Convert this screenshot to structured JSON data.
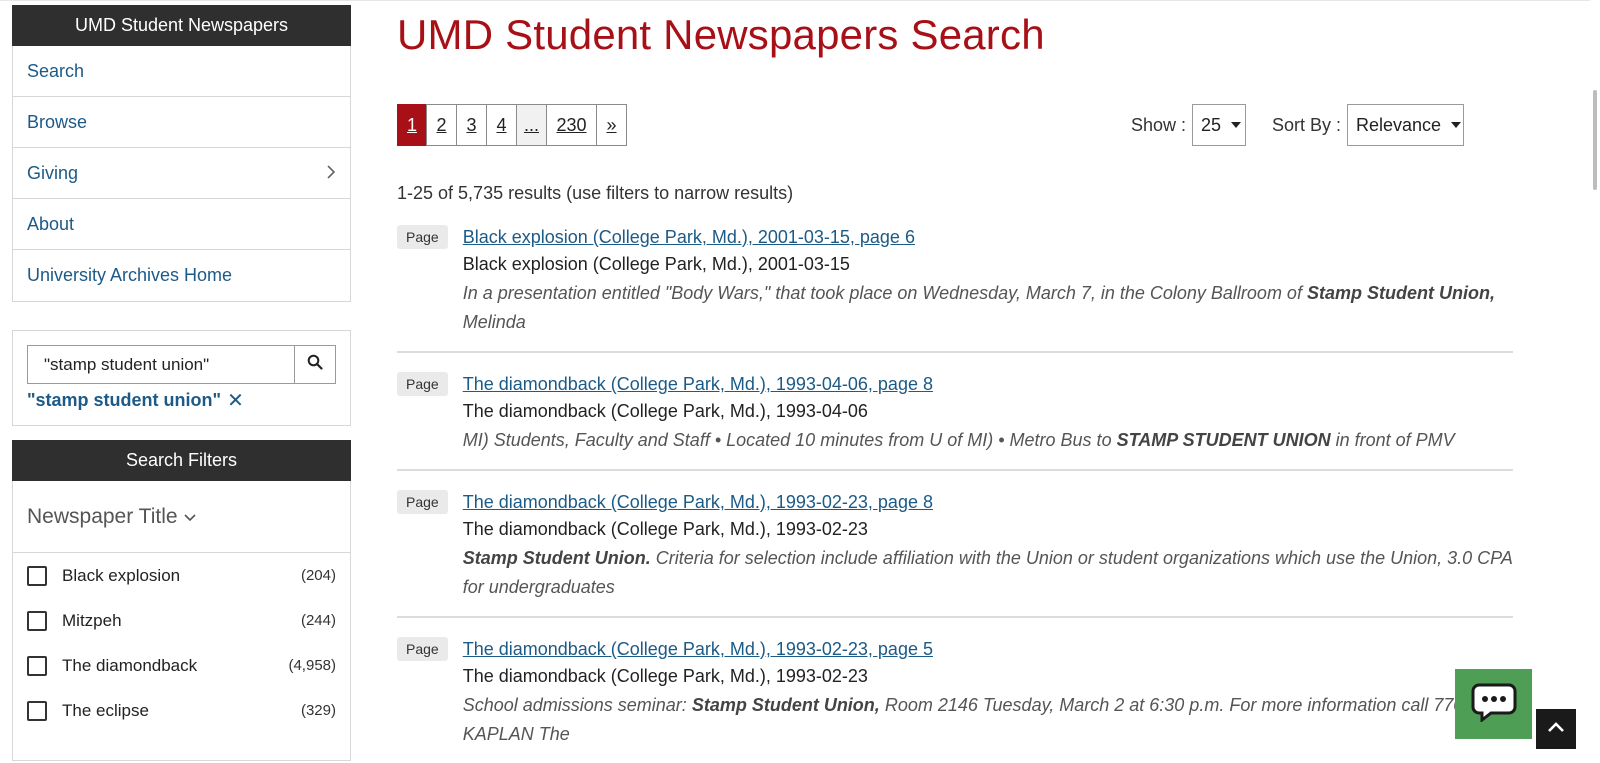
{
  "sidebar": {
    "header": "UMD Student Newspapers",
    "nav": [
      {
        "label": "Search",
        "has_submenu": false
      },
      {
        "label": "Browse",
        "has_submenu": false
      },
      {
        "label": "Giving",
        "has_submenu": true
      },
      {
        "label": "About",
        "has_submenu": false
      },
      {
        "label": "University Archives Home",
        "has_submenu": false
      }
    ],
    "search": {
      "value": "\"stamp student union\"",
      "active_query": "\"stamp student union\""
    },
    "filters": {
      "header": "Search Filters",
      "group_title": "Newspaper Title",
      "items": [
        {
          "label": "Black explosion",
          "count": "(204)"
        },
        {
          "label": "Mitzpeh",
          "count": "(244)"
        },
        {
          "label": "The diamondback",
          "count": "(4,958)"
        },
        {
          "label": "The eclipse",
          "count": "(329)"
        }
      ]
    }
  },
  "main": {
    "title": "UMD Student Newspapers Search",
    "pager": [
      "1",
      "2",
      "3",
      "4",
      "...",
      "230",
      "»"
    ],
    "show_label": "Show :",
    "show_value": "25",
    "sort_label": "Sort By :",
    "sort_value": "Relevance",
    "results_count": "1-25 of 5,735 results (use filters to narrow results)",
    "results": [
      {
        "badge": "Page",
        "link": "Black explosion (College Park, Md.), 2001-03-15, page 6",
        "subtitle": "Black explosion (College Park, Md.), 2001-03-15",
        "snippet_1": "In a presentation entitled \"Body Wars,\" that took place on Wednesday, March 7, in the Colony Ballroom of ",
        "snippet_hl": "Stamp Student Union,",
        "snippet_2": " Melinda"
      },
      {
        "badge": "Page",
        "link": "The diamondback (College Park, Md.), 1993-04-06, page 8",
        "subtitle": "The diamondback (College Park, Md.), 1993-04-06",
        "snippet_1": "MI) Students, Faculty and Staff • Located 10 minutes from U of MI) • Metro Bus to ",
        "snippet_hl": "STAMP STUDENT UNION",
        "snippet_2": " in front of PMV"
      },
      {
        "badge": "Page",
        "link": "The diamondback (College Park, Md.), 1993-02-23, page 8",
        "subtitle": "The diamondback (College Park, Md.), 1993-02-23",
        "snippet_1": "",
        "snippet_hl": "Stamp Student Union.",
        "snippet_2": " Criteria for selection include affiliation with the Union or student organizations which use the Union, 3.0 CPA for undergraduates"
      },
      {
        "badge": "Page",
        "link": "The diamondback (College Park, Md.), 1993-02-23, page 5",
        "subtitle": "The diamondback (College Park, Md.), 1993-02-23",
        "snippet_1": "School admissions seminar: ",
        "snippet_hl": "Stamp Student Union,",
        "snippet_2": " Room 2146 Tuesday, March 2 at 6:30 p.m. For more information call 770-3444 KAPLAN The"
      }
    ]
  },
  "widgets": {
    "chat_icon": "chat-bubble-icon",
    "back_to_top_icon": "chevron-up-icon"
  }
}
